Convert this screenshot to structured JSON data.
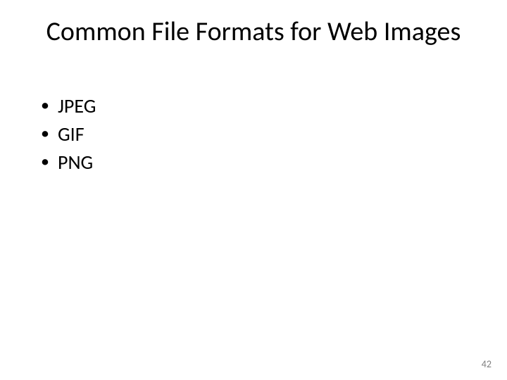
{
  "slide": {
    "title": "Common File Formats for Web Images",
    "bullets": [
      "JPEG",
      "GIF",
      "PNG"
    ],
    "page_number": "42"
  }
}
